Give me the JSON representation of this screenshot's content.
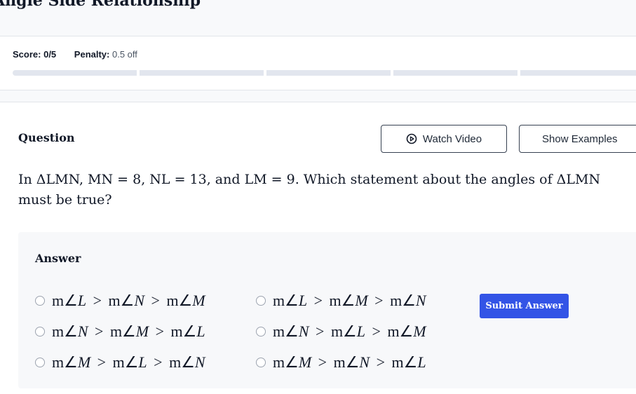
{
  "header": {
    "title": "Angle Side Relationship"
  },
  "score": {
    "score_label": "Score:",
    "score_value": "0/5",
    "penalty_label": "Penalty:",
    "penalty_value": "0.5 off",
    "progress_segments_total": 5,
    "progress_segments_filled": 0
  },
  "question": {
    "label": "Question",
    "watch_video_label": "Watch Video",
    "show_examples_label": "Show Examples",
    "text": "In ΔLMN, MN = 8, NL = 13, and LM = 9. Which statement about the angles of ΔLMN must be true?"
  },
  "answer": {
    "label": "Answer",
    "options": [
      {
        "parts": [
          "L",
          "N",
          "M"
        ],
        "text": "m∠L > m∠N > m∠M"
      },
      {
        "parts": [
          "L",
          "M",
          "N"
        ],
        "text": "m∠L > m∠M > m∠N"
      },
      {
        "parts": [
          "N",
          "M",
          "L"
        ],
        "text": "m∠N > m∠M > m∠L"
      },
      {
        "parts": [
          "N",
          "L",
          "M"
        ],
        "text": "m∠N > m∠L > m∠M"
      },
      {
        "parts": [
          "M",
          "L",
          "N"
        ],
        "text": "m∠M > m∠L > m∠N"
      },
      {
        "parts": [
          "M",
          "N",
          "L"
        ],
        "text": "m∠M > m∠N > m∠L"
      }
    ],
    "submit_label": "Submit Answer"
  },
  "colors": {
    "accent": "#3354e6",
    "panel_bg": "#f7f8fa",
    "progress_bg": "#e2e6ee"
  }
}
